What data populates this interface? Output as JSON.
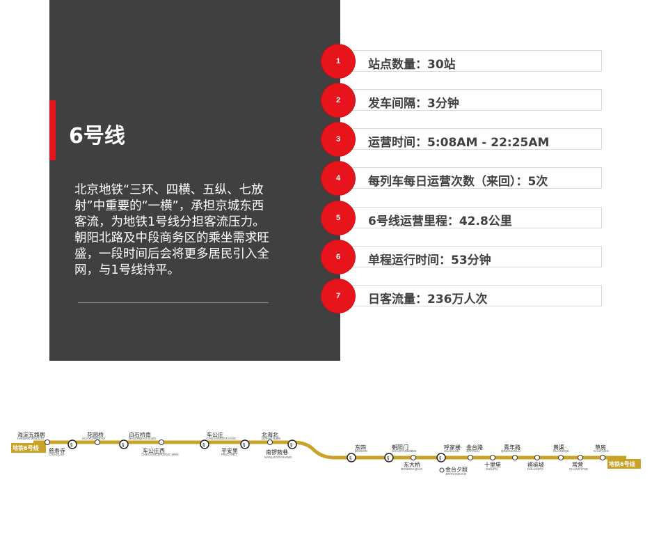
{
  "panel": {
    "title": "6号线",
    "description": "北京地铁“三环、四横、五纵、七放射”中重要的“一横”，承担京城东西客流，为地铁1号线分担客流压力。朝阳北路及中段商务区的乘坐需求旺盛，一段时间后会将更多居民引入全网，与1号线持平。"
  },
  "stats": [
    {
      "num": "1",
      "text": "站点数量：30站"
    },
    {
      "num": "2",
      "text": "发车间隔：3分钟"
    },
    {
      "num": "3",
      "text": "运营时间：5:08AM - 22:25AM"
    },
    {
      "num": "4",
      "text": "每列车每日运营次数（来回）：5次"
    },
    {
      "num": "5",
      "text": "6号线运营里程：42.8公里"
    },
    {
      "num": "6",
      "text": "单程运行时间：53分钟"
    },
    {
      "num": "7",
      "text": "日客流量：236万人次"
    }
  ],
  "colors": {
    "accent": "#e8141b",
    "panel": "#404040",
    "line": "#c9a227"
  },
  "map": {
    "badge_left": "地铁6号线",
    "badge_right": "地铁6号线",
    "stations": [
      {
        "zh": "海淀五路居",
        "en": "HAIDIAN WULUJU"
      },
      {
        "zh": "慈寿寺",
        "en": "CISHOUSI"
      },
      {
        "zh": "花园桥",
        "en": "HUAYUANQIAO"
      },
      {
        "zh": "白石桥南",
        "en": "BAISHIQIAO South"
      },
      {
        "zh": "车公庄西",
        "en": "CHEGONGZHUANG West"
      },
      {
        "zh": "车公庄",
        "en": "CHEGONGZHUANG"
      },
      {
        "zh": "平安里",
        "en": "PING'ANLI"
      },
      {
        "zh": "北海北",
        "en": "BEIHAI North"
      },
      {
        "zh": "南锣鼓巷",
        "en": "NANLUOGUXIANG"
      },
      {
        "zh": "东四",
        "en": "DONGSI"
      },
      {
        "zh": "朝阳门",
        "en": "CHAOYANGMEN"
      },
      {
        "zh": "东大桥",
        "en": "DONGDAQIAO"
      },
      {
        "zh": "呼家楼",
        "en": "HUJIALOU"
      },
      {
        "zh": "金台路",
        "en": "JINTAILU"
      },
      {
        "zh": "金台夕照",
        "en": "JINTAIXIZHAO"
      },
      {
        "zh": "十里堡",
        "en": "SHILIPU"
      },
      {
        "zh": "青年路",
        "en": "QINGNIANLU"
      },
      {
        "zh": "褡裢坡",
        "en": "DALIANPO"
      },
      {
        "zh": "黄渠",
        "en": "HUANGQU"
      },
      {
        "zh": "常营",
        "en": "CHANGYING"
      },
      {
        "zh": "草房",
        "en": "CAOFANG"
      }
    ]
  }
}
